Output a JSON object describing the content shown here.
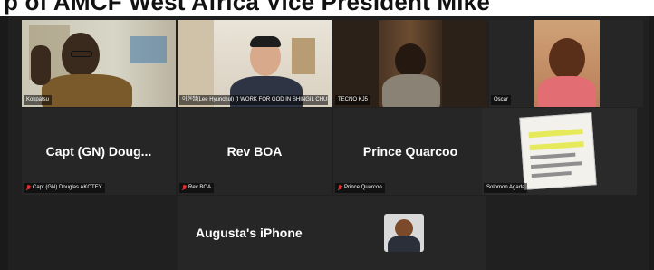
{
  "banner": {
    "headline": "p of AMCF West Africa Vice President Mike"
  },
  "participants": [
    {
      "id": "p1",
      "label": "Kokpatsu",
      "center_name": "",
      "muted": false
    },
    {
      "id": "p2",
      "label": "이현철(Lee Hyunchul) (I WORK FOR GOD IN SHINGIL CHURCH...",
      "center_name": "",
      "muted": false
    },
    {
      "id": "p3",
      "label": "TECNO KJ5",
      "center_name": "",
      "muted": false
    },
    {
      "id": "p4",
      "label": "Oscar",
      "center_name": "",
      "muted": false
    },
    {
      "id": "p5",
      "label": "Capt (GN) Douglas AKOTEY",
      "center_name": "Capt (GN) Doug...",
      "muted": true
    },
    {
      "id": "p6",
      "label": "Rev BOA",
      "center_name": "Rev BOA",
      "muted": true
    },
    {
      "id": "p7",
      "label": "Prince Quarcoo",
      "center_name": "Prince Quarcoo",
      "muted": true
    },
    {
      "id": "p8",
      "label": "Solomon Agada",
      "center_name": "",
      "muted": false,
      "active_speaker": true
    },
    {
      "id": "p9",
      "label": "",
      "center_name": "Augusta's iPhone",
      "muted": false
    }
  ],
  "colors": {
    "active_speaker_border": "#23d96a",
    "muted_icon": "#e0302f",
    "tile_bg": "#262626"
  }
}
